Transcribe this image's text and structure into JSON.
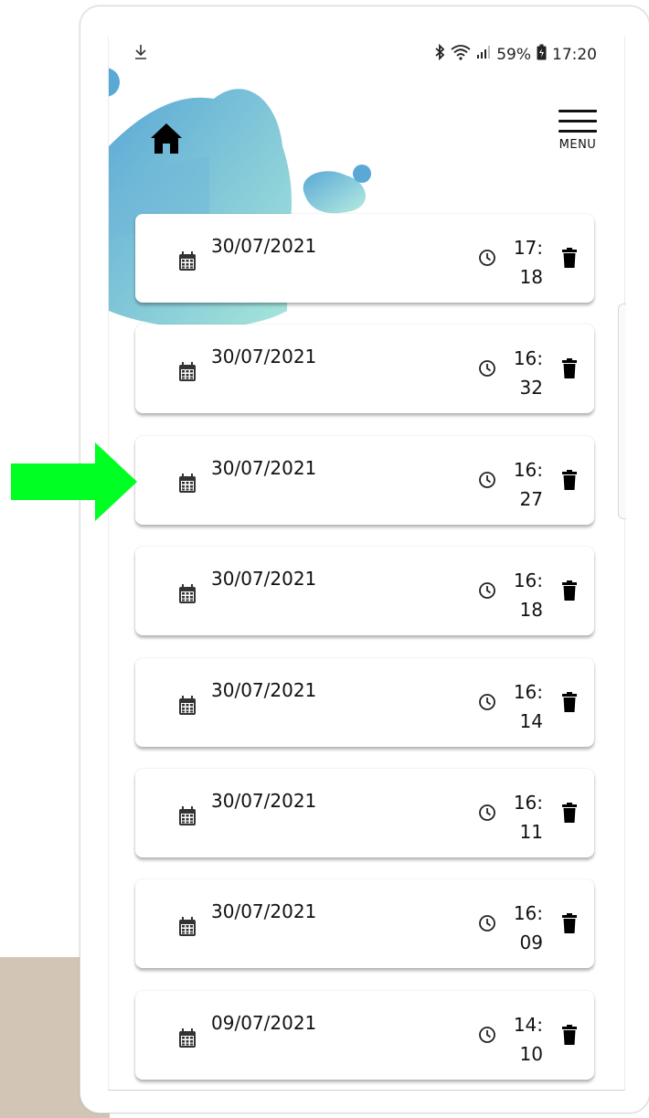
{
  "status_bar": {
    "left_icon": "download-icon",
    "battery": "59%",
    "clock": "17:20"
  },
  "header": {
    "home_icon": "home-icon",
    "menu_label": "MENU"
  },
  "records": [
    {
      "date": "30/07/2021",
      "time_hour": "17:",
      "time_minute": "18"
    },
    {
      "date": "30/07/2021",
      "time_hour": "16:",
      "time_minute": "32"
    },
    {
      "date": "30/07/2021",
      "time_hour": "16:",
      "time_minute": "27"
    },
    {
      "date": "30/07/2021",
      "time_hour": "16:",
      "time_minute": "18"
    },
    {
      "date": "30/07/2021",
      "time_hour": "16:",
      "time_minute": "14"
    },
    {
      "date": "30/07/2021",
      "time_hour": "16:",
      "time_minute": "11"
    },
    {
      "date": "30/07/2021",
      "time_hour": "16:",
      "time_minute": "09"
    },
    {
      "date": "09/07/2021",
      "time_hour": "14:",
      "time_minute": "10"
    }
  ],
  "colors": {
    "blob_light": "#a8e6da",
    "blob_dark": "#5aa8d6",
    "arrow": "#00ff22",
    "backdrop": "#d3c5b5"
  }
}
